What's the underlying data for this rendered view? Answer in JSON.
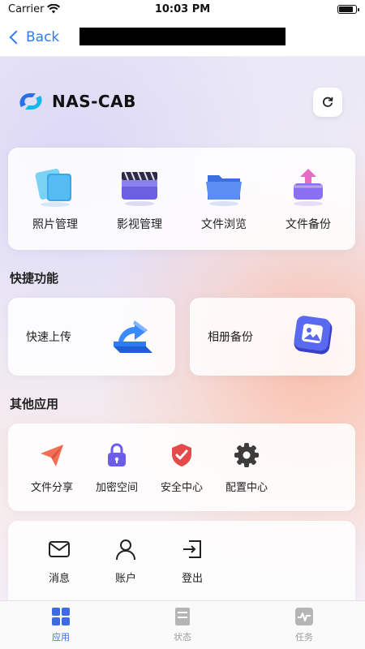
{
  "status_bar": {
    "carrier": "Carrier",
    "time": "10:03 PM"
  },
  "nav": {
    "back_label": "Back"
  },
  "brand": {
    "name": "NAS-CAB"
  },
  "main_tiles": [
    {
      "label": "照片管理",
      "icon": "photos-icon"
    },
    {
      "label": "影视管理",
      "icon": "video-icon"
    },
    {
      "label": "文件浏览",
      "icon": "folder-icon"
    },
    {
      "label": "文件备份",
      "icon": "backup-icon"
    }
  ],
  "quick": {
    "title": "快捷功能",
    "items": [
      {
        "label": "快速上传",
        "icon": "upload-arrow-icon"
      },
      {
        "label": "相册备份",
        "icon": "album-image-icon"
      }
    ]
  },
  "other": {
    "title": "其他应用",
    "items": [
      {
        "label": "文件分享",
        "icon": "paper-plane-icon"
      },
      {
        "label": "加密空间",
        "icon": "lock-icon"
      },
      {
        "label": "安全中心",
        "icon": "shield-check-icon"
      },
      {
        "label": "配置中心",
        "icon": "gear-icon"
      }
    ]
  },
  "account": {
    "items": [
      {
        "label": "消息",
        "icon": "mail-icon"
      },
      {
        "label": "账户",
        "icon": "user-icon"
      },
      {
        "label": "登出",
        "icon": "logout-icon"
      }
    ]
  },
  "tabs": [
    {
      "label": "应用",
      "icon": "grid-icon",
      "active": true
    },
    {
      "label": "状态",
      "icon": "server-icon",
      "active": false
    },
    {
      "label": "任务",
      "icon": "activity-icon",
      "active": false
    }
  ],
  "colors": {
    "accent": "#2f7bf5",
    "tab_active": "#3d6ce0",
    "tab_inactive": "#9a9a9a"
  }
}
